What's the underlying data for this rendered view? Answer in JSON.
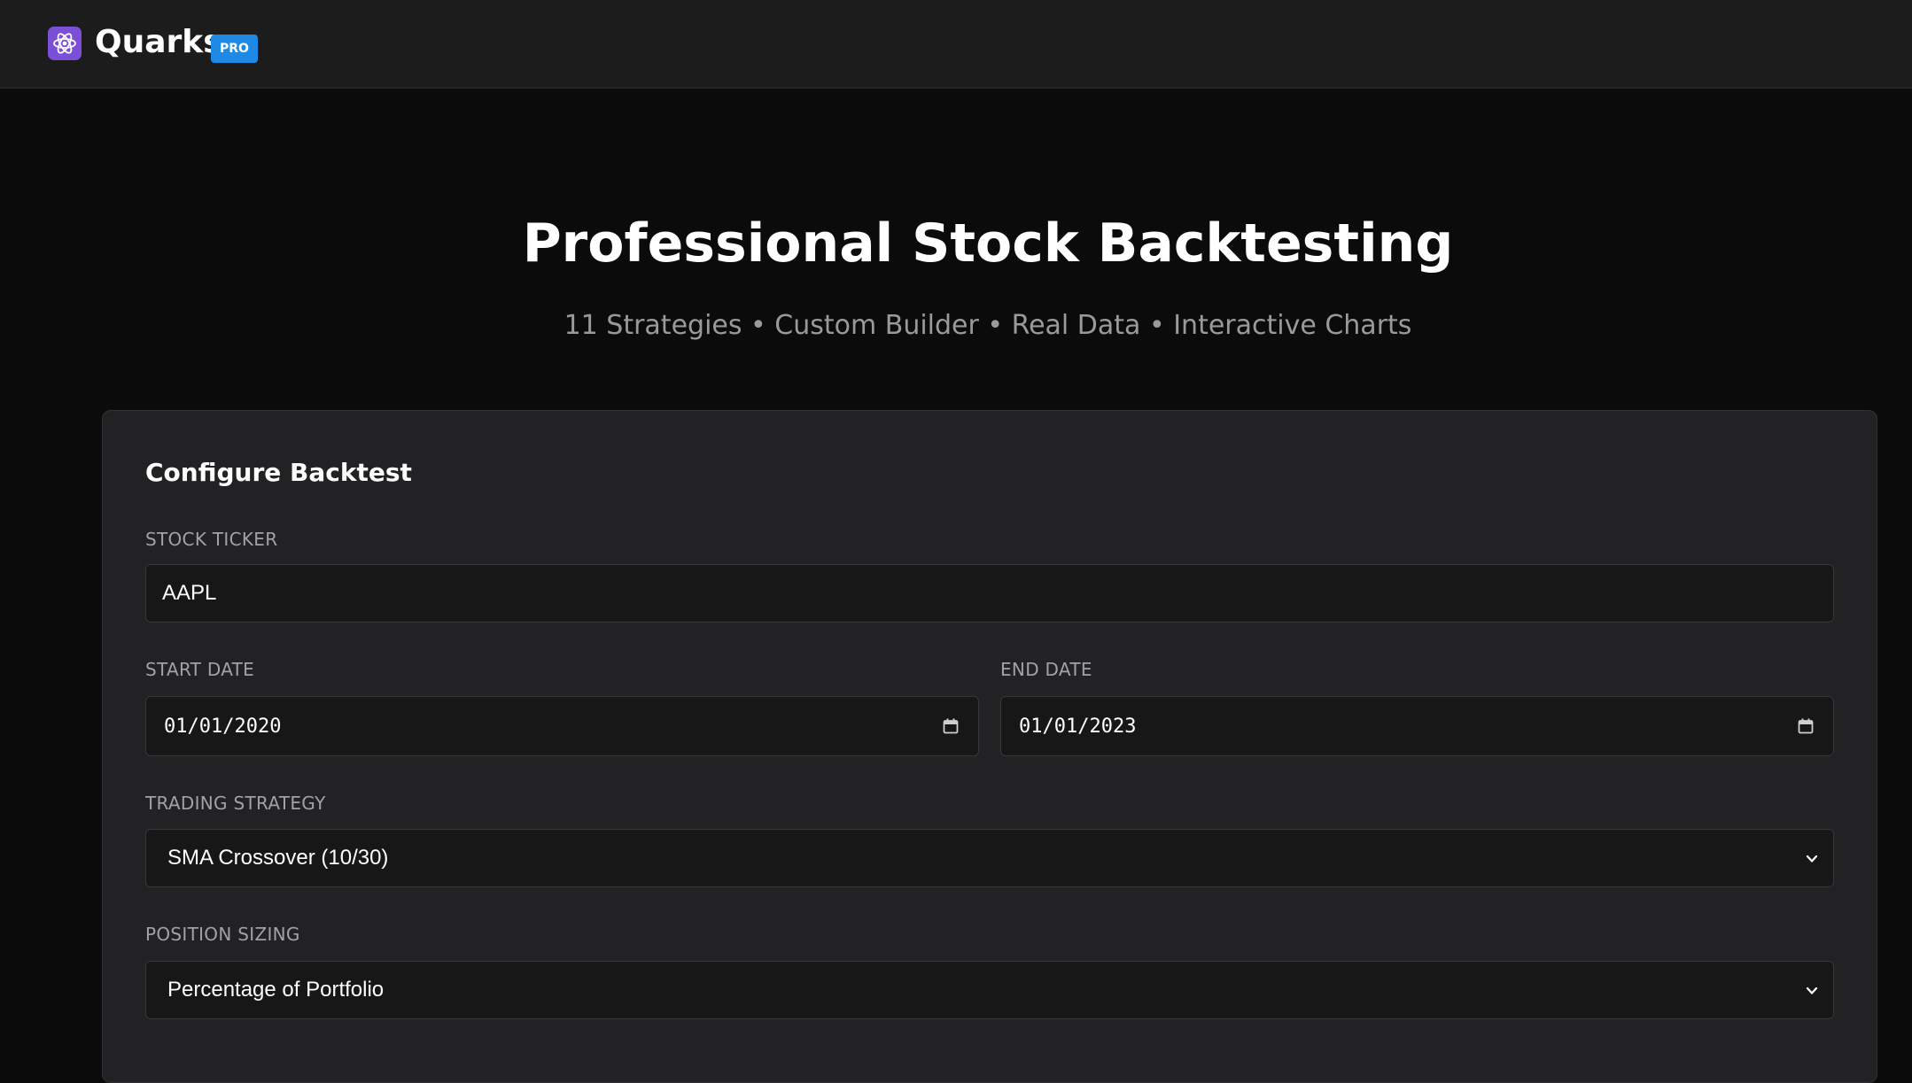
{
  "header": {
    "app_name": "Quarks",
    "badge": "PRO",
    "logo_icon": "atom-icon"
  },
  "hero": {
    "title": "Professional Stock Backtesting",
    "subtitle": "11 Strategies • Custom Builder • Real Data • Interactive Charts"
  },
  "form": {
    "title": "Configure Backtest",
    "ticker": {
      "label": "STOCK TICKER",
      "value": "AAPL"
    },
    "start_date": {
      "label": "START DATE",
      "value": "01/01/2020",
      "icon": "calendar-icon"
    },
    "end_date": {
      "label": "END DATE",
      "value": "01/01/2023",
      "icon": "calendar-icon"
    },
    "strategy": {
      "label": "TRADING STRATEGY",
      "value": "SMA Crossover (10/30)",
      "icon": "chevron-down-icon"
    },
    "position_sizing": {
      "label": "POSITION SIZING",
      "value": "Percentage of Portfolio",
      "icon": "chevron-down-icon"
    }
  },
  "colors": {
    "background": "#0b0b0c",
    "header_bg": "#1c1c1d",
    "card_bg": "#222224",
    "input_bg": "#171718",
    "logo_accent": "#7b4fd6",
    "badge_blue": "#1e8ae6"
  }
}
